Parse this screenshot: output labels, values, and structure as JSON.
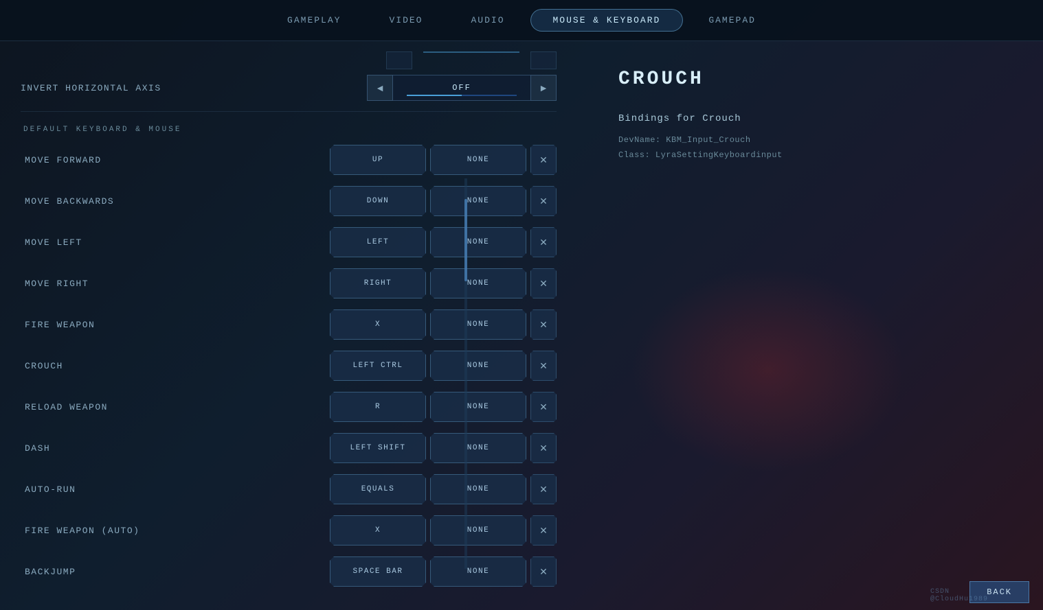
{
  "nav": {
    "tabs": [
      {
        "id": "gameplay",
        "label": "GAMEPLAY",
        "active": false
      },
      {
        "id": "video",
        "label": "VIDEO",
        "active": false
      },
      {
        "id": "audio",
        "label": "AUDIO",
        "active": false
      },
      {
        "id": "mouse-keyboard",
        "label": "MOUSE & KEYBOARD",
        "active": true
      },
      {
        "id": "gamepad",
        "label": "GAMEPAD",
        "active": false
      }
    ]
  },
  "invert_axis": {
    "label": "Invert Horizontal Axis",
    "value": "OFF",
    "left_arrow": "◄",
    "right_arrow": "►"
  },
  "section_label": "DEFAULT KEYBOARD & MOUSE",
  "bindings": [
    {
      "action": "Move Forward",
      "key1": "UP",
      "key2": "NONE"
    },
    {
      "action": "Move Backwards",
      "key1": "DOWN",
      "key2": "NONE"
    },
    {
      "action": "Move Left",
      "key1": "LEFT",
      "key2": "NONE"
    },
    {
      "action": "Move Right",
      "key1": "RIGHT",
      "key2": "NONE"
    },
    {
      "action": "Fire Weapon",
      "key1": "X",
      "key2": "NONE"
    },
    {
      "action": "Crouch",
      "key1": "LEFT CTRL",
      "key2": "NONE"
    },
    {
      "action": "Reload Weapon",
      "key1": "R",
      "key2": "NONE"
    },
    {
      "action": "Dash",
      "key1": "LEFT SHIFT",
      "key2": "NONE"
    },
    {
      "action": "Auto-run",
      "key1": "EQUALS",
      "key2": "NONE"
    },
    {
      "action": "Fire Weapon (Auto)",
      "key1": "X",
      "key2": "NONE"
    },
    {
      "action": "BackJump",
      "key1": "SPACE BAR",
      "key2": "NONE"
    }
  ],
  "right_panel": {
    "title": "CROUCH",
    "bindings_label": "Bindings for Crouch",
    "dev_name": "DevName: KBM_Input_Crouch",
    "class_name": "Class: LyraSettingKeyboardinput"
  },
  "bottom": {
    "back_label": "BACK",
    "watermark": "CSDN @CloudHu1989"
  }
}
